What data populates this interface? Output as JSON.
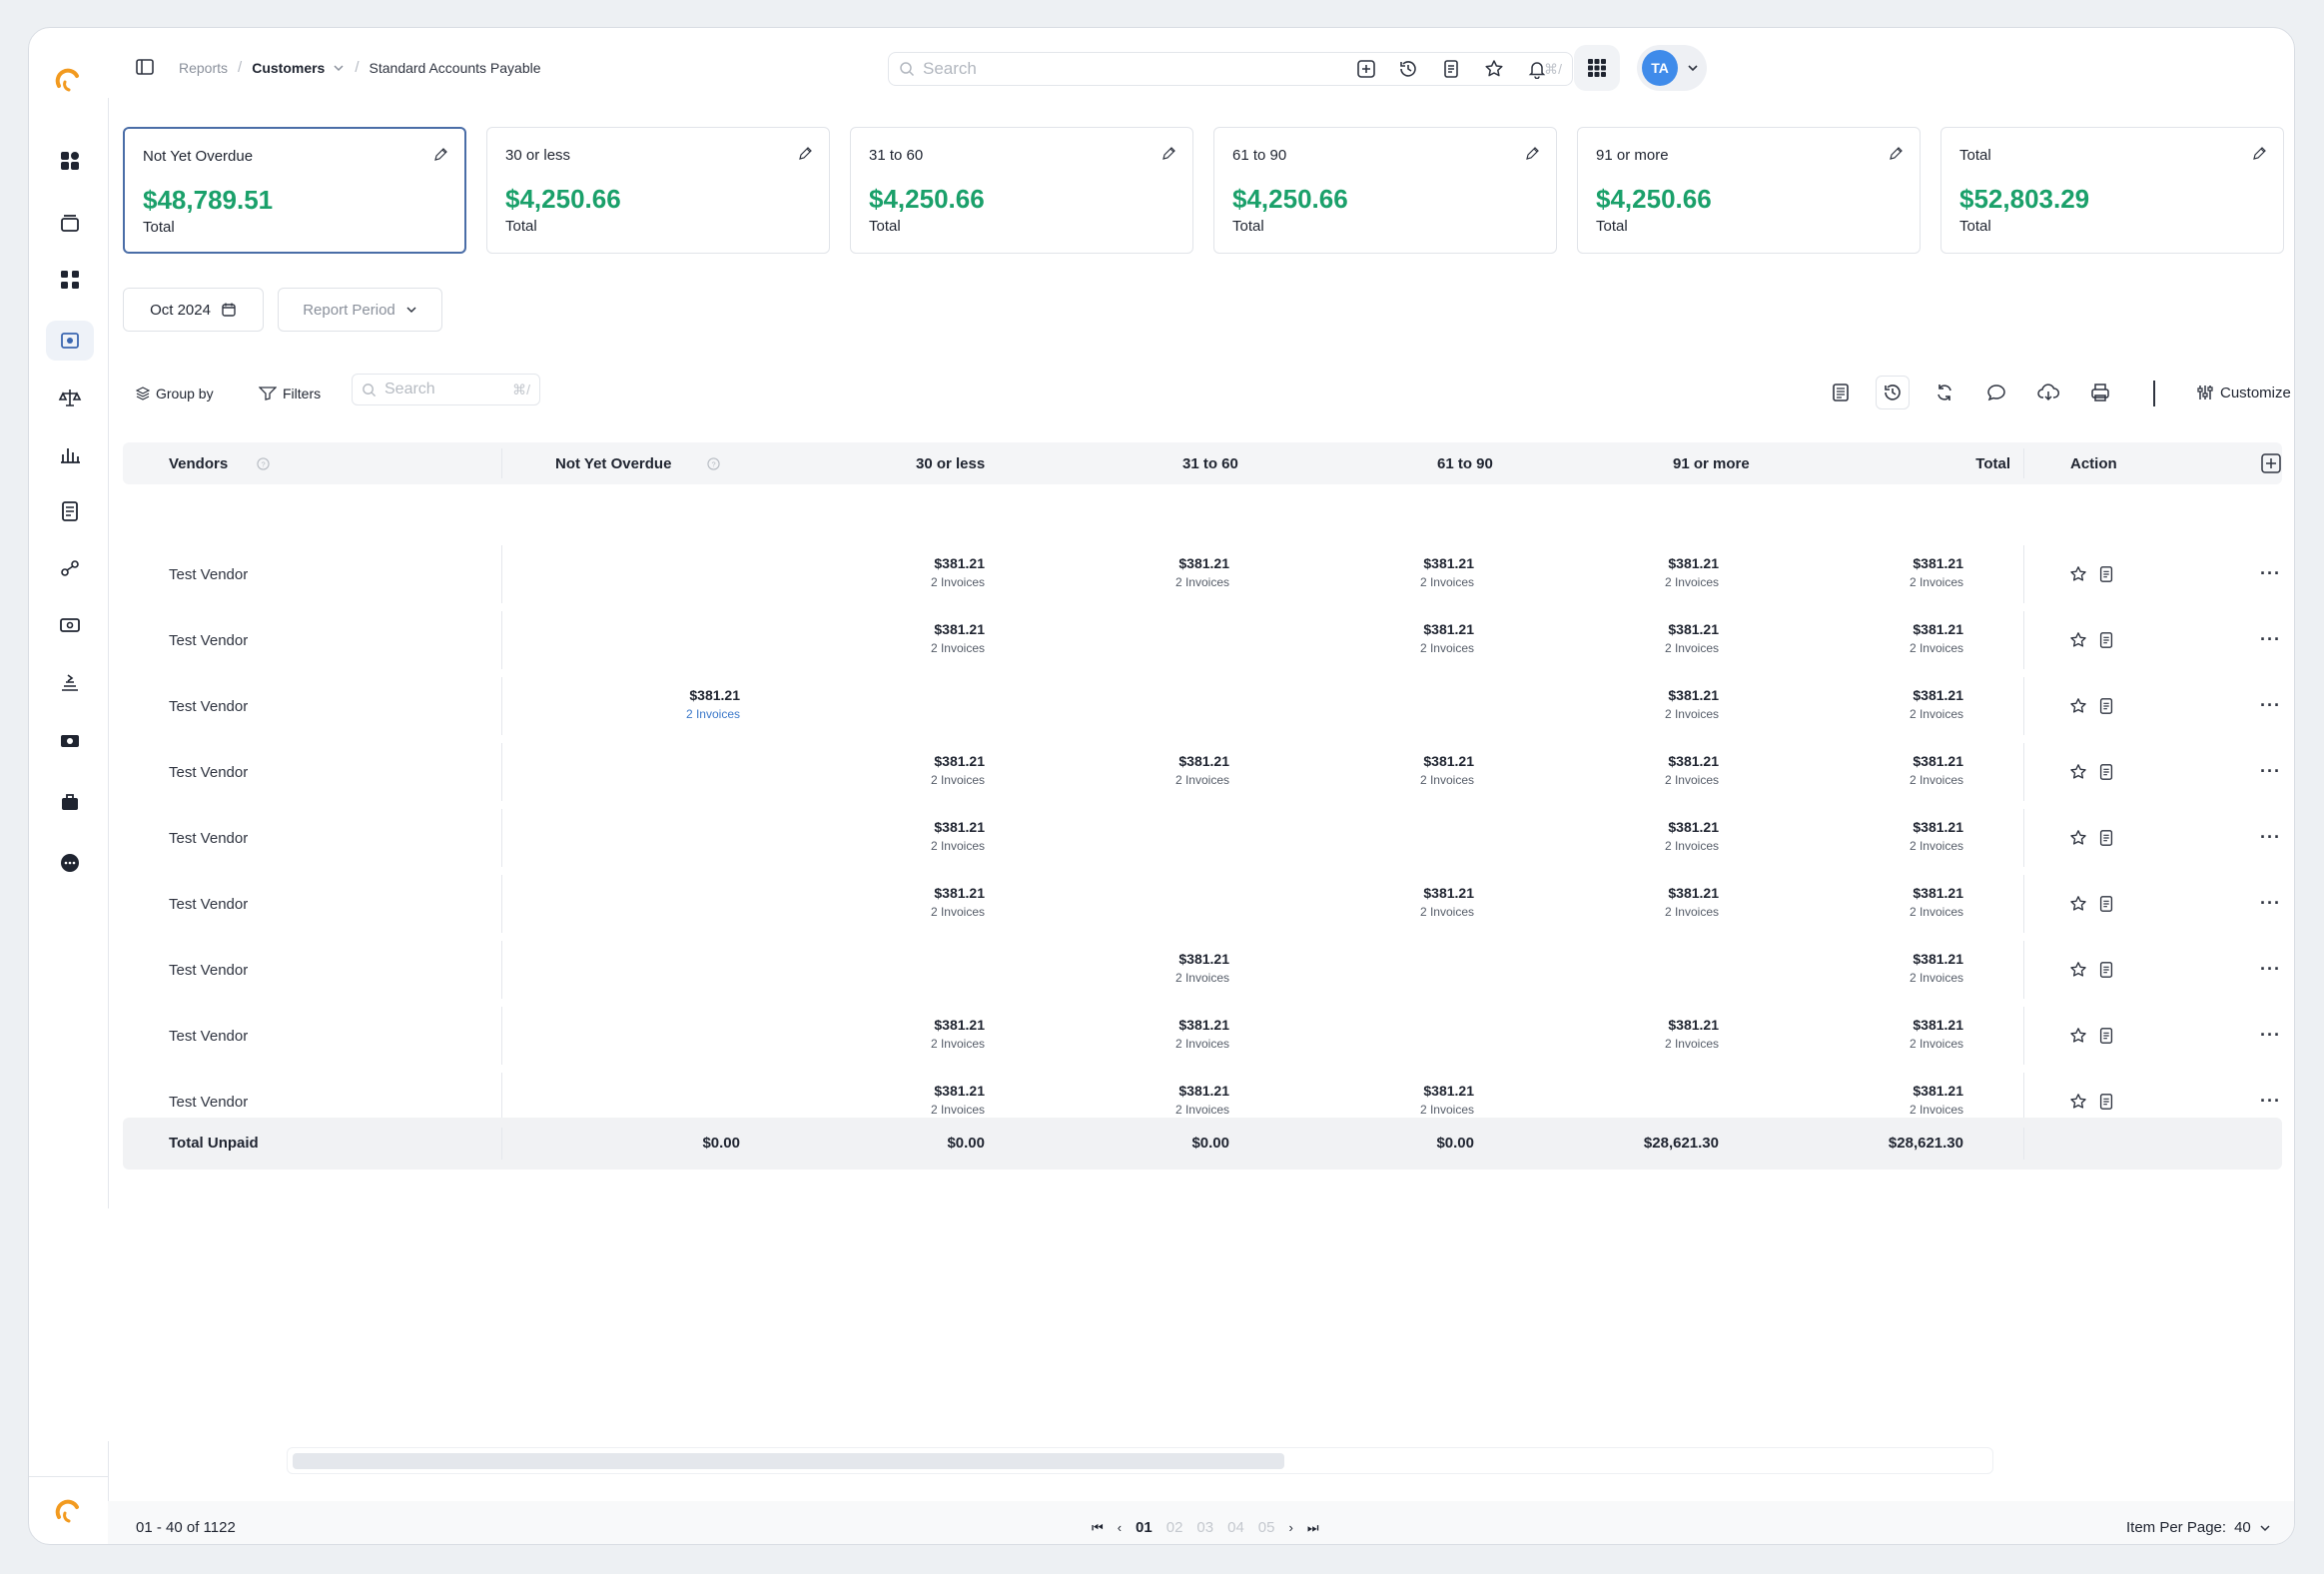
{
  "breadcrumb": {
    "items": [
      "Reports",
      "Customers",
      "Standard Accounts Payable"
    ]
  },
  "search": {
    "placeholder": "Search",
    "shortcut": "⌘/"
  },
  "user": {
    "initials": "TA"
  },
  "cards": [
    {
      "title": "Not Yet Overdue",
      "value": "$48,789.51",
      "sub": "Total"
    },
    {
      "title": "30 or less",
      "value": "$4,250.66",
      "sub": "Total"
    },
    {
      "title": "31 to 60",
      "value": "$4,250.66",
      "sub": "Total"
    },
    {
      "title": "61 to 90",
      "value": "$4,250.66",
      "sub": "Total"
    },
    {
      "title": "91 or more",
      "value": "$4,250.66",
      "sub": "Total"
    },
    {
      "title": "Total",
      "value": "$52,803.29",
      "sub": "Total"
    }
  ],
  "filters": {
    "date": "Oct 2024",
    "period": "Report Period"
  },
  "toolbar": {
    "group_by": "Group by",
    "filters": "Filters",
    "search_placeholder": "Search",
    "search_shortcut": "⌘/",
    "customize": "Customize"
  },
  "table": {
    "headers": [
      "Vendors",
      "Not Yet Overdue",
      "30 or less",
      "31 to 60",
      "61 to 90",
      "91 or more",
      "Total",
      "Action"
    ],
    "rows": [
      {
        "vendor": "Test Vendor",
        "cells": [
          null,
          [
            "$381.21",
            "2 Invoices"
          ],
          [
            "$381.21",
            "2 Invoices"
          ],
          [
            "$381.21",
            "2 Invoices"
          ],
          [
            "$381.21",
            "2 Invoices"
          ],
          [
            "$381.21",
            "2 Invoices"
          ]
        ]
      },
      {
        "vendor": "Test Vendor",
        "cells": [
          null,
          [
            "$381.21",
            "2 Invoices"
          ],
          null,
          [
            "$381.21",
            "2 Invoices"
          ],
          [
            "$381.21",
            "2 Invoices"
          ],
          [
            "$381.21",
            "2 Invoices"
          ]
        ]
      },
      {
        "vendor": "Test Vendor",
        "cells": [
          [
            "$381.21",
            "2 Invoices"
          ],
          null,
          null,
          null,
          [
            "$381.21",
            "2 Invoices"
          ],
          [
            "$381.21",
            "2 Invoices"
          ]
        ]
      },
      {
        "vendor": "Test Vendor",
        "cells": [
          null,
          [
            "$381.21",
            "2 Invoices"
          ],
          [
            "$381.21",
            "2 Invoices"
          ],
          [
            "$381.21",
            "2 Invoices"
          ],
          [
            "$381.21",
            "2 Invoices"
          ],
          [
            "$381.21",
            "2 Invoices"
          ]
        ]
      },
      {
        "vendor": "Test Vendor",
        "cells": [
          null,
          [
            "$381.21",
            "2 Invoices"
          ],
          null,
          null,
          [
            "$381.21",
            "2 Invoices"
          ],
          [
            "$381.21",
            "2 Invoices"
          ]
        ]
      },
      {
        "vendor": "Test Vendor",
        "cells": [
          null,
          [
            "$381.21",
            "2 Invoices"
          ],
          null,
          [
            "$381.21",
            "2 Invoices"
          ],
          [
            "$381.21",
            "2 Invoices"
          ],
          [
            "$381.21",
            "2 Invoices"
          ]
        ]
      },
      {
        "vendor": "Test Vendor",
        "cells": [
          null,
          null,
          [
            "$381.21",
            "2 Invoices"
          ],
          null,
          null,
          [
            "$381.21",
            "2 Invoices"
          ]
        ]
      },
      {
        "vendor": "Test Vendor",
        "cells": [
          null,
          [
            "$381.21",
            "2 Invoices"
          ],
          [
            "$381.21",
            "2 Invoices"
          ],
          null,
          [
            "$381.21",
            "2 Invoices"
          ],
          [
            "$381.21",
            "2 Invoices"
          ]
        ]
      },
      {
        "vendor": "Test Vendor",
        "cells": [
          null,
          [
            "$381.21",
            "2 Invoices"
          ],
          [
            "$381.21",
            "2 Invoices"
          ],
          [
            "$381.21",
            "2 Invoices"
          ],
          null,
          [
            "$381.21",
            "2 Invoices"
          ]
        ]
      }
    ],
    "total": {
      "label": "Total Unpaid",
      "values": [
        "$0.00",
        "$0.00",
        "$0.00",
        "$0.00",
        "$28,621.30",
        "$28,621.30"
      ]
    }
  },
  "pagination": {
    "range": "01 - 40 of 1122",
    "pages": [
      "01",
      "02",
      "03",
      "04",
      "05"
    ],
    "current": "01",
    "per_page_label": "Item Per Page:",
    "per_page": "40"
  },
  "colors": {
    "accent_green": "#1aa06a",
    "selected_border": "#4a6da7",
    "avatar": "#3f8bea",
    "link": "#3b78c9"
  }
}
